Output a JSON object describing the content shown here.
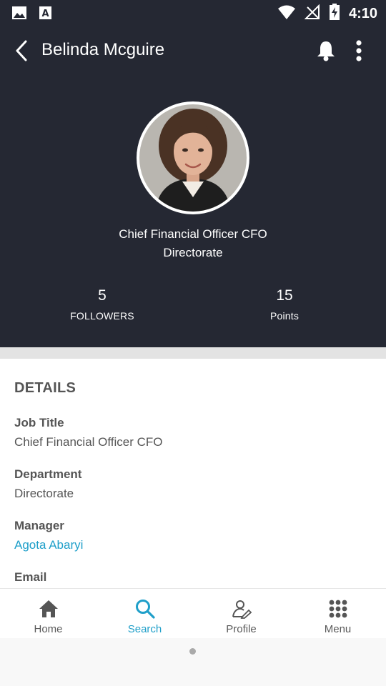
{
  "status_bar": {
    "time": "4:10",
    "icons": [
      "image-icon",
      "text-a-icon",
      "wifi-icon",
      "no-signal-icon",
      "battery-charging-icon"
    ]
  },
  "app_bar": {
    "title": "Belinda Mcguire",
    "icons": [
      "back-arrow-icon",
      "bell-icon",
      "more-vertical-icon"
    ]
  },
  "profile": {
    "job_title_line": "Chief Financial Officer CFO",
    "department_line": "Directorate",
    "stats": [
      {
        "value": "5",
        "label": "FOLLOWERS"
      },
      {
        "value": "15",
        "label": "Points"
      }
    ]
  },
  "details": {
    "heading": "DETAILS",
    "fields": [
      {
        "label": "Job Title",
        "value": "Chief Financial Officer CFO"
      },
      {
        "label": "Department",
        "value": "Directorate"
      },
      {
        "label": "Manager",
        "value": "Agota Abaryi"
      },
      {
        "label": "Email",
        "value": ""
      }
    ]
  },
  "bottom_nav": {
    "items": [
      {
        "label": "Home",
        "icon": "home-icon"
      },
      {
        "label": "Search",
        "icon": "search-icon",
        "active": true
      },
      {
        "label": "Profile",
        "icon": "profile-icon"
      },
      {
        "label": "Menu",
        "icon": "grid-menu-icon"
      }
    ]
  },
  "colors": {
    "header_bg": "#252833",
    "accent": "#1f9fc9",
    "text_muted": "#555555"
  }
}
